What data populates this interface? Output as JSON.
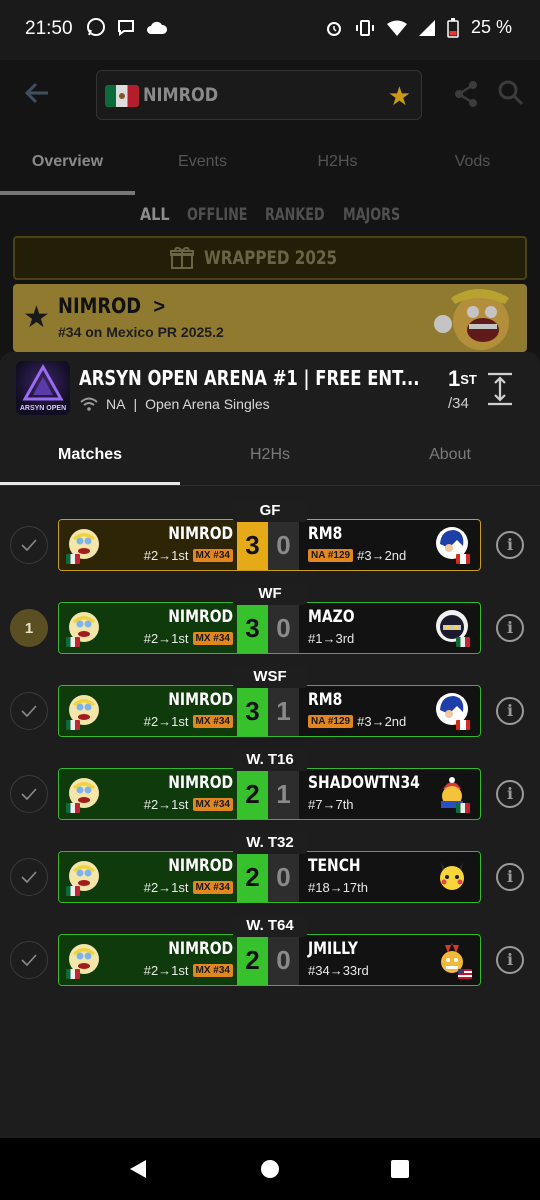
{
  "status_bar": {
    "time": "21:50",
    "battery": "25 %"
  },
  "header": {
    "player_name": "NIMROD"
  },
  "main_tabs": [
    {
      "label": "Overview"
    },
    {
      "label": "Events"
    },
    {
      "label": "H2Hs"
    },
    {
      "label": "Vods"
    }
  ],
  "filters": [
    {
      "label": "ALL"
    },
    {
      "label": "OFFLINE"
    },
    {
      "label": "RANKED"
    },
    {
      "label": "MAJORS"
    }
  ],
  "wrapped_label": "WRAPPED 2025",
  "player_card": {
    "name": "NIMROD",
    "chevron": ">",
    "subtitle": "#34 on Mexico PR 2025.2"
  },
  "tournament": {
    "title": "ARSYN OPEN ARENA #1 | FREE ENT...",
    "region": "NA",
    "event": "Open Arena Singles",
    "separator": "|",
    "placement": "1",
    "placement_suffix": "ST",
    "entrants": "/34",
    "logo_text": "ARSYN OPEN"
  },
  "sheet_tabs": [
    {
      "label": "Matches"
    },
    {
      "label": "H2Hs"
    },
    {
      "label": "About"
    }
  ],
  "matches": [
    {
      "round": "GF",
      "status": "done",
      "status_text": "",
      "style": "gold",
      "p1": {
        "name": "NIMROD",
        "seed": "#2→1st",
        "badge": "MX #34"
      },
      "p1_score": "3",
      "p2_score": "0",
      "p2": {
        "name": "RM8",
        "seed": "#3→2nd",
        "badge": "NA #129",
        "flag": "ca",
        "avatar": "blue"
      }
    },
    {
      "round": "WF",
      "status": "pending",
      "status_text": "1",
      "style": "green",
      "p1": {
        "name": "NIMROD",
        "seed": "#2→1st",
        "badge": "MX #34"
      },
      "p1_score": "3",
      "p2_score": "0",
      "p2": {
        "name": "MAZO",
        "seed": "#1→3rd",
        "badge": "",
        "flag": "mx",
        "avatar": "meta"
      }
    },
    {
      "round": "WSF",
      "status": "done",
      "status_text": "",
      "style": "green",
      "p1": {
        "name": "NIMROD",
        "seed": "#2→1st",
        "badge": "MX #34"
      },
      "p1_score": "3",
      "p2_score": "1",
      "p2": {
        "name": "RM8",
        "seed": "#3→2nd",
        "badge": "NA #129",
        "flag": "ca",
        "avatar": "blue"
      }
    },
    {
      "round": "W. T16",
      "status": "done",
      "status_text": "",
      "style": "green",
      "p1": {
        "name": "NIMROD",
        "seed": "#2→1st",
        "badge": "MX #34"
      },
      "p1_score": "2",
      "p2_score": "1",
      "p2": {
        "name": "SHADOWTN34",
        "seed": "#7→7th",
        "badge": "",
        "flag": "mx",
        "avatar": "dedede"
      }
    },
    {
      "round": "W. T32",
      "status": "done",
      "status_text": "",
      "style": "green",
      "p1": {
        "name": "NIMROD",
        "seed": "#2→1st",
        "badge": "MX #34"
      },
      "p1_score": "2",
      "p2_score": "0",
      "p2": {
        "name": "TENCH",
        "seed": "#18→17th",
        "badge": "",
        "flag": "",
        "avatar": "pika"
      }
    },
    {
      "round": "W. T64",
      "status": "done",
      "status_text": "",
      "style": "green",
      "p1": {
        "name": "NIMROD",
        "seed": "#2→1st",
        "badge": "MX #34"
      },
      "p1_score": "2",
      "p2_score": "0",
      "p2": {
        "name": "JMILLY",
        "seed": "#34→33rd",
        "badge": "",
        "flag": "us",
        "avatar": "bowser"
      }
    }
  ],
  "colors": {
    "gold": "#e6aa19",
    "green": "#37c22d",
    "pr_badge": "#e1871e"
  }
}
